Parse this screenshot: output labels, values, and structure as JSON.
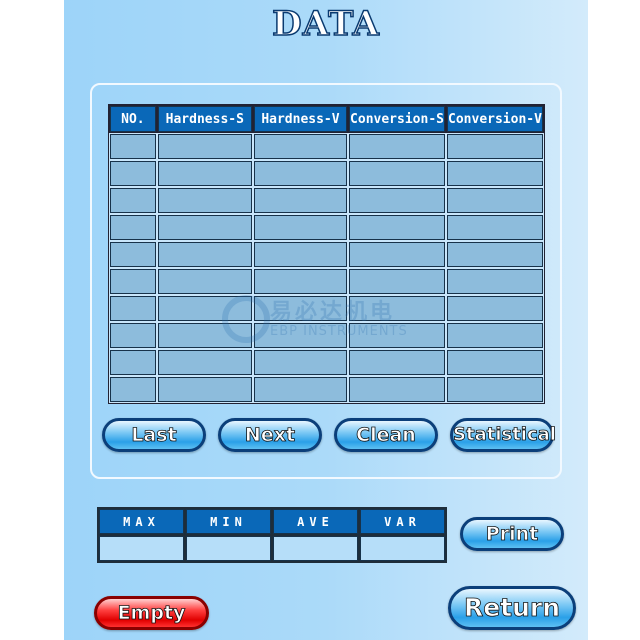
{
  "title": "DATA",
  "table": {
    "columns": [
      "NO.",
      "Hardness-S",
      "Hardness-V",
      "Conversion-S",
      "Conversion-V"
    ],
    "row_count": 10
  },
  "buttons": {
    "last": "Last",
    "next": "Next",
    "clean": "Clean",
    "statistical": "Statistical",
    "print": "Print",
    "empty": "Empty",
    "return": "Return"
  },
  "stats": {
    "columns": [
      "MAX",
      "MIN",
      "AVE",
      "VAR"
    ]
  },
  "watermark": {
    "cn": "易必达机电",
    "en": "EBP INSTRUMENTS"
  },
  "colors": {
    "header": "#0a68b8",
    "button_blue": "#2aa0e8",
    "button_red": "#e00000"
  }
}
